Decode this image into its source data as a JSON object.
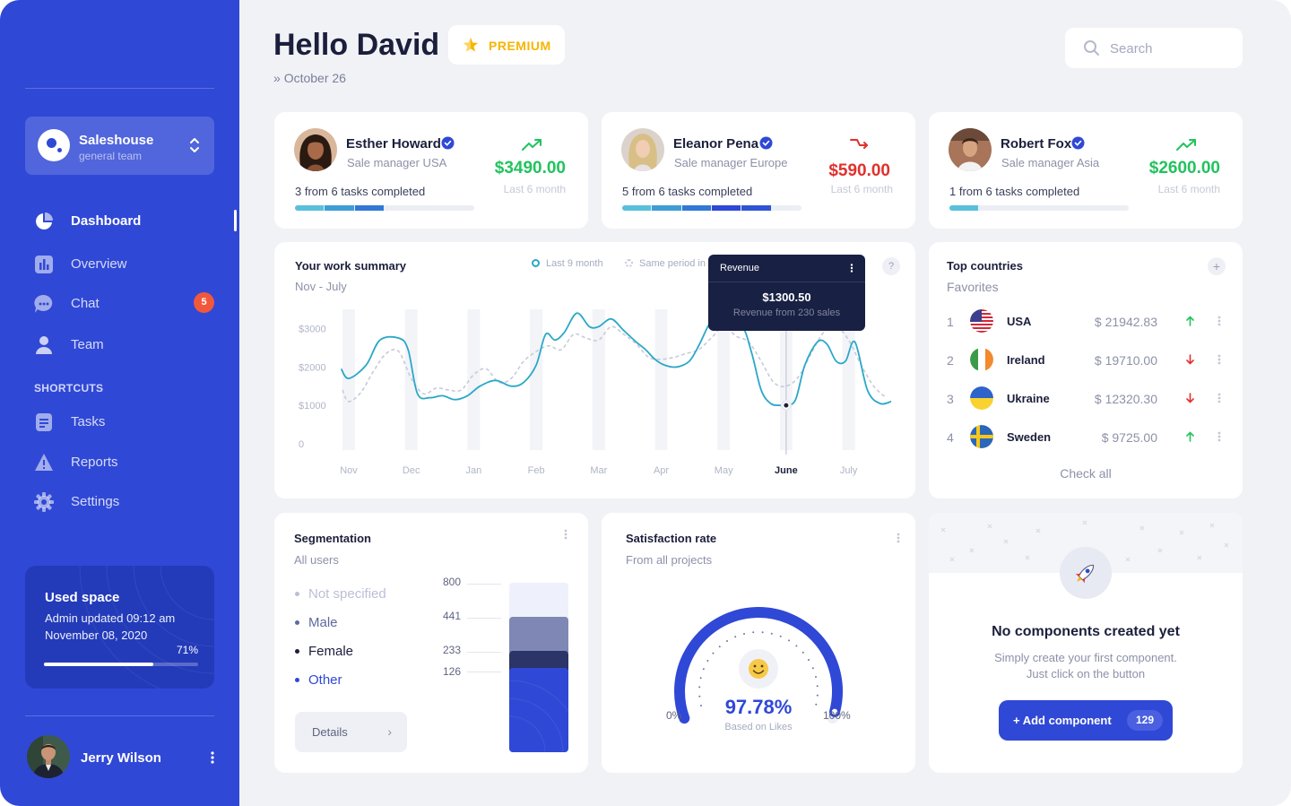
{
  "sidebar": {
    "team": {
      "name": "Saleshouse",
      "subtitle": "general team"
    },
    "nav": [
      {
        "label": "Dashboard",
        "icon": "pie-chart-icon",
        "active": true
      },
      {
        "label": "Overview",
        "icon": "bar-chart-icon"
      },
      {
        "label": "Chat",
        "icon": "chat-bubble-icon",
        "badge": "5"
      },
      {
        "label": "Team",
        "icon": "user-icon"
      }
    ],
    "shortcuts_heading": "SHORTCUTS",
    "shortcuts": [
      {
        "label": "Tasks",
        "icon": "document-icon"
      },
      {
        "label": "Reports",
        "icon": "warning-icon"
      },
      {
        "label": "Settings",
        "icon": "gear-icon"
      }
    ],
    "used_space": {
      "title": "Used space",
      "line1": "Admin updated 09:12 am",
      "line2": "November 08, 2020",
      "percent_label": "71%",
      "percent": 71
    },
    "user": {
      "name": "Jerry Wilson"
    }
  },
  "header": {
    "greeting": "Hello David",
    "badge": "PREMIUM",
    "date": "October 26",
    "search_placeholder": "Search"
  },
  "managers": [
    {
      "name": "Esther Howard",
      "role": "Sale manager USA",
      "tasks": "3 from 6 tasks completed",
      "completed": 3,
      "total": 6,
      "value": "$3490.00",
      "period": "Last 6 month",
      "trend": "up"
    },
    {
      "name": "Eleanor Pena",
      "role": "Sale manager Europe",
      "tasks": "5 from 6 tasks completed",
      "completed": 5,
      "total": 6,
      "value": "$590.00",
      "period": "Last 6 month",
      "trend": "down"
    },
    {
      "name": "Robert Fox",
      "role": "Sale manager Asia",
      "tasks": "1 from 6 tasks completed",
      "completed": 1,
      "total": 6,
      "value": "$2600.00",
      "period": "Last 6 month",
      "trend": "up"
    }
  ],
  "work_summary": {
    "title": "Your work summary",
    "subtitle": "Nov - July",
    "legend": [
      "Last 9 month",
      "Same period in"
    ],
    "tooltip": {
      "title": "Revenue",
      "value": "$1300.50",
      "note": "Revenue from 230 sales"
    }
  },
  "chart_data": {
    "type": "line",
    "title": "Your work summary",
    "subtitle": "Nov - July",
    "xlabel": "",
    "ylabel": "",
    "x_ticks": [
      "Nov",
      "Dec",
      "Jan",
      "Feb",
      "Mar",
      "Apr",
      "May",
      "June",
      "July"
    ],
    "highlighted_tick": "June",
    "y_ticks": [
      "0",
      "$1000",
      "$2000",
      "$3000"
    ],
    "ylim": [
      0,
      3500
    ],
    "grid": "vertical",
    "legend": "top",
    "series": [
      {
        "name": "Last 9 month",
        "color": "#2aa8c8",
        "x": [
          -0.12,
          0.0,
          0.28,
          0.5,
          0.8,
          0.95,
          1.1,
          1.3,
          1.5,
          1.7,
          1.9,
          2.1,
          2.35,
          2.6,
          2.8,
          3.0,
          3.15,
          3.3,
          3.45,
          3.65,
          3.85,
          4.0,
          4.2,
          4.4,
          4.6,
          4.75,
          4.9,
          5.05,
          5.25,
          5.45,
          5.6,
          5.8,
          5.95,
          6.1,
          6.3,
          6.45,
          6.6,
          6.75,
          6.9,
          7.0,
          7.15,
          7.3,
          7.5,
          7.65,
          7.8,
          7.95,
          8.1,
          8.3,
          8.5,
          8.68
        ],
        "y": [
          1950,
          1700,
          2050,
          2700,
          2750,
          2450,
          1300,
          1200,
          1250,
          1150,
          1250,
          1500,
          1650,
          1500,
          1600,
          2050,
          2850,
          2700,
          2900,
          3400,
          3050,
          3050,
          3250,
          2950,
          2650,
          2450,
          2200,
          2050,
          2000,
          2150,
          2550,
          3200,
          3250,
          3000,
          3050,
          2350,
          1400,
          1050,
          1000,
          1000,
          1150,
          2050,
          2650,
          2600,
          2150,
          2150,
          2650,
          1400,
          1050,
          1100
        ]
      },
      {
        "name": "Same period in",
        "color": "#c6cbda",
        "x": [
          -0.1,
          0.0,
          0.2,
          0.4,
          0.6,
          0.8,
          1.0,
          1.2,
          1.4,
          1.6,
          1.8,
          2.0,
          2.2,
          2.4,
          2.6,
          2.8,
          3.0,
          3.2,
          3.4,
          3.6,
          3.8,
          4.0,
          4.2,
          4.4,
          4.6,
          4.8,
          5.0,
          5.2,
          5.4,
          5.6,
          5.8,
          6.0,
          6.2,
          6.4,
          6.6,
          6.8,
          7.0,
          7.2,
          7.4,
          7.6,
          7.8,
          8.0,
          8.2,
          8.4,
          8.6
        ],
        "y": [
          1400,
          1100,
          1350,
          1900,
          2350,
          2400,
          1700,
          1300,
          1450,
          1400,
          1400,
          1800,
          1950,
          1600,
          1700,
          2150,
          2400,
          2550,
          2450,
          2850,
          2750,
          2700,
          3050,
          2850,
          2600,
          2250,
          2200,
          2250,
          2350,
          2450,
          2750,
          3050,
          2800,
          2650,
          2150,
          1600,
          1500,
          1750,
          2350,
          2900,
          3050,
          2700,
          2050,
          1500,
          1200
        ]
      }
    ],
    "highlight_point": {
      "x": 7,
      "y": 1000
    }
  },
  "top_countries": {
    "title": "Top countries",
    "subtitle": "Favorites",
    "rows": [
      {
        "rank": "1",
        "name": "USA",
        "amount": "$ 21942.83",
        "trend": "up",
        "flag": "usa-flag-icon"
      },
      {
        "rank": "2",
        "name": "Ireland",
        "amount": "$ 19710.00",
        "trend": "down",
        "flag": "ireland-flag-icon"
      },
      {
        "rank": "3",
        "name": "Ukraine",
        "amount": "$ 12320.30",
        "trend": "down",
        "flag": "ukraine-flag-icon"
      },
      {
        "rank": "4",
        "name": "Sweden",
        "amount": "$ 9725.00",
        "trend": "up",
        "flag": "sweden-flag-icon"
      }
    ],
    "check_all": "Check all"
  },
  "segmentation": {
    "title": "Segmentation",
    "subtitle": "All users",
    "items": [
      {
        "label": "Not specified",
        "value": "800",
        "color": "#b9bfd6",
        "bar_color": "#eef1fb"
      },
      {
        "label": "Male",
        "value": "441",
        "color": "#5f6a9c",
        "bar_color": "#7f88b4"
      },
      {
        "label": "Female",
        "value": "233",
        "color": "#1b1f3b",
        "bar_color": "#2c3567"
      },
      {
        "label": "Other",
        "value": "126",
        "color": "#3048d6",
        "bar_color": "#3048d6"
      }
    ],
    "details": "Details"
  },
  "satisfaction": {
    "title": "Satisfaction rate",
    "subtitle": "From all projects",
    "value": "97.78%",
    "value_num": 97.78,
    "note": "Based on Likes",
    "min": "0%",
    "max": "100%"
  },
  "empty_state": {
    "title": "No components created yet",
    "line1": "Simply create your first component.",
    "line2": "Just click on the button",
    "button": "+ Add component",
    "count": "129"
  },
  "colors": {
    "brand": "#3048d6",
    "up": "#22c35d",
    "down": "#e0312d",
    "premium": "#f7b500",
    "chart_line": "#2aa8c8"
  }
}
